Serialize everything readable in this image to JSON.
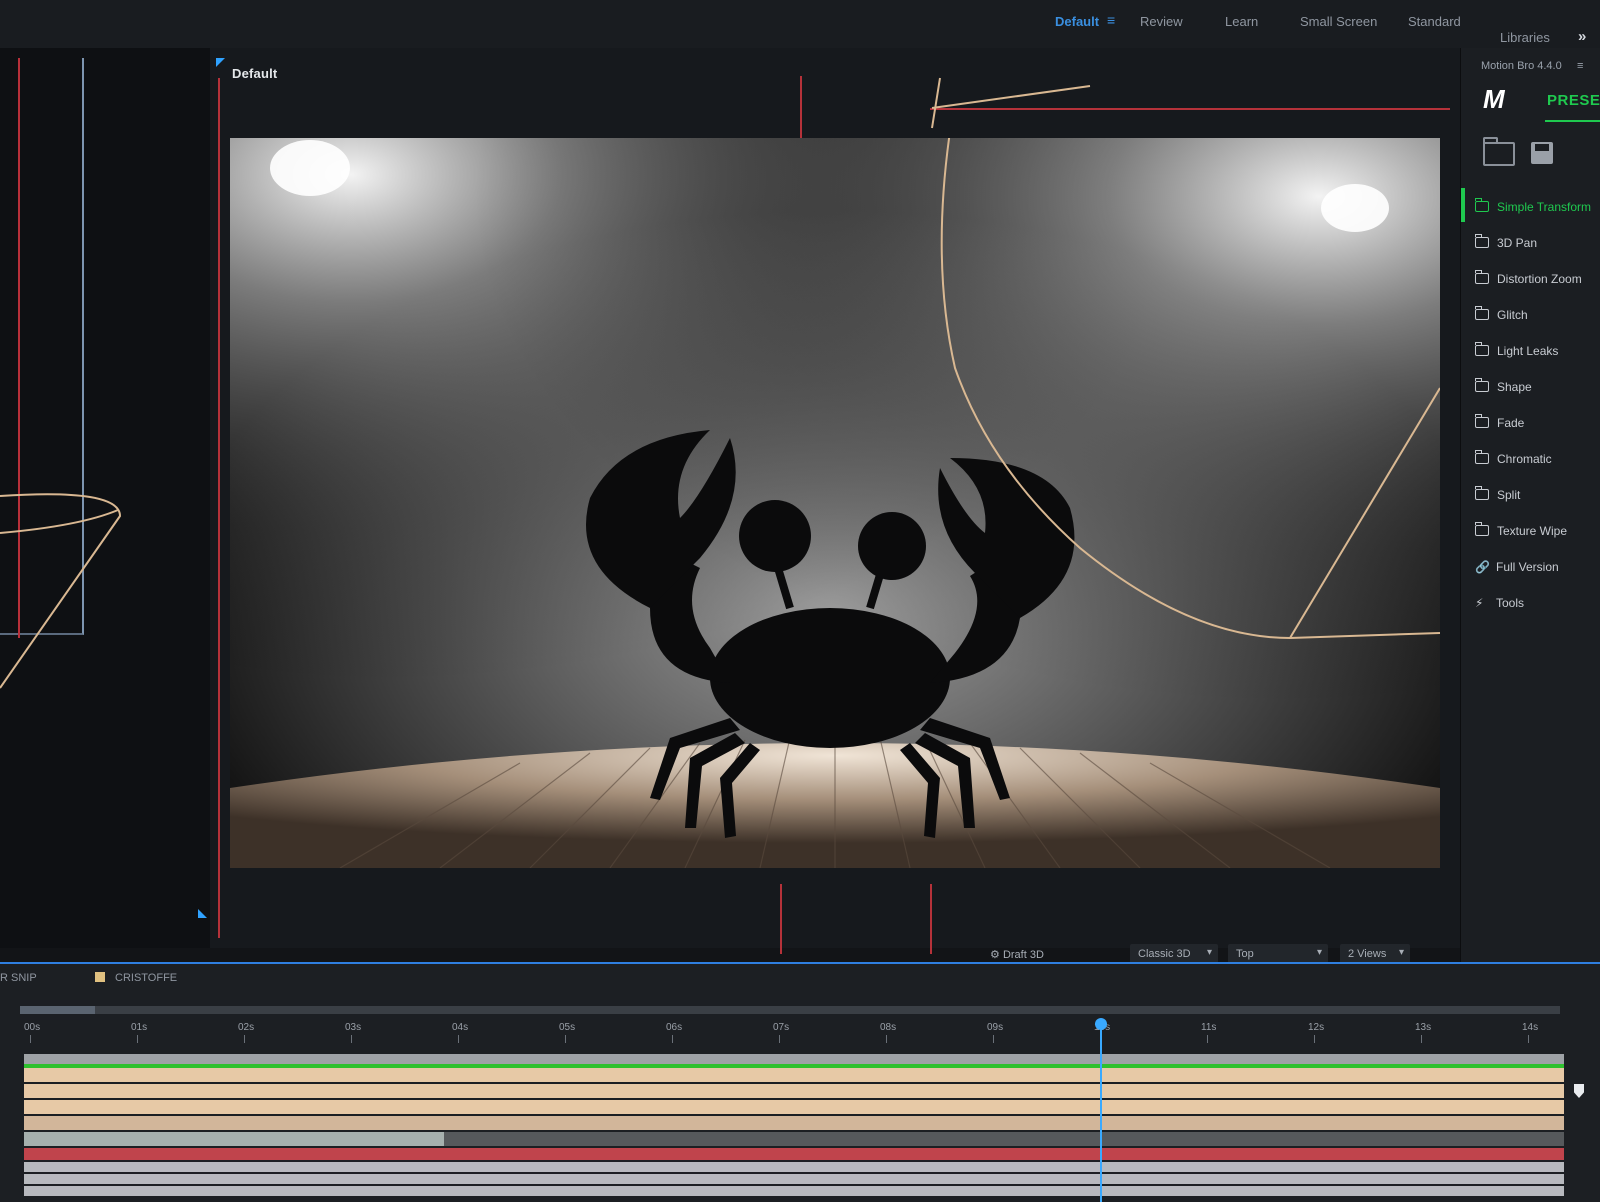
{
  "workspaces": [
    {
      "label": "Default",
      "active": true
    },
    {
      "label": "Review",
      "active": false
    },
    {
      "label": "Learn",
      "active": false
    },
    {
      "label": "Small Screen",
      "active": false
    },
    {
      "label": "Standard",
      "active": false
    },
    {
      "label": "Libraries",
      "active": false
    }
  ],
  "workspace_menu_icon": "hamburger-menu-icon",
  "more_workspaces_icon": "double-chevron-right-icon",
  "viewer": {
    "label": "Default"
  },
  "plugin": {
    "title": "Motion Bro 4.4.0",
    "logo": "M",
    "tab_label": "PRESETS",
    "folder_icon": "folder-icon",
    "save_icon": "save-icon",
    "accent": "#1fc94f",
    "presets": [
      {
        "label": "Simple Transform",
        "icon": "folder-icon",
        "active": true
      },
      {
        "label": "3D Pan",
        "icon": "folder-icon",
        "active": false
      },
      {
        "label": "Distortion Zoom",
        "icon": "folder-icon",
        "active": false
      },
      {
        "label": "Glitch",
        "icon": "folder-icon",
        "active": false
      },
      {
        "label": "Light Leaks",
        "icon": "folder-icon",
        "active": false
      },
      {
        "label": "Shape",
        "icon": "folder-icon",
        "active": false
      },
      {
        "label": "Fade",
        "icon": "folder-icon",
        "active": false
      },
      {
        "label": "Chromatic",
        "icon": "folder-icon",
        "active": false
      },
      {
        "label": "Split",
        "icon": "folder-icon",
        "active": false
      },
      {
        "label": "Texture Wipe",
        "icon": "folder-icon",
        "active": false
      },
      {
        "label": "Full Version",
        "icon": "link-icon",
        "active": false
      },
      {
        "label": "Tools",
        "icon": "lightning-icon",
        "active": false
      }
    ]
  },
  "viewer_options": {
    "draft_label": "Draft 3D",
    "renderer": "Classic 3D",
    "view": "Top",
    "layout": "2 Views"
  },
  "timeline": {
    "tabs": [
      "R SNIP",
      "CRISTOFFE"
    ],
    "tab_swatch_color": "#e0c080",
    "ticks": [
      "00s",
      "01s",
      "02s",
      "03s",
      "04s",
      "05s",
      "06s",
      "07s",
      "08s",
      "09s",
      "10s",
      "11s",
      "12s",
      "13s",
      "14s"
    ],
    "playhead_seconds": 10,
    "playhead_color": "#39a9ff"
  }
}
